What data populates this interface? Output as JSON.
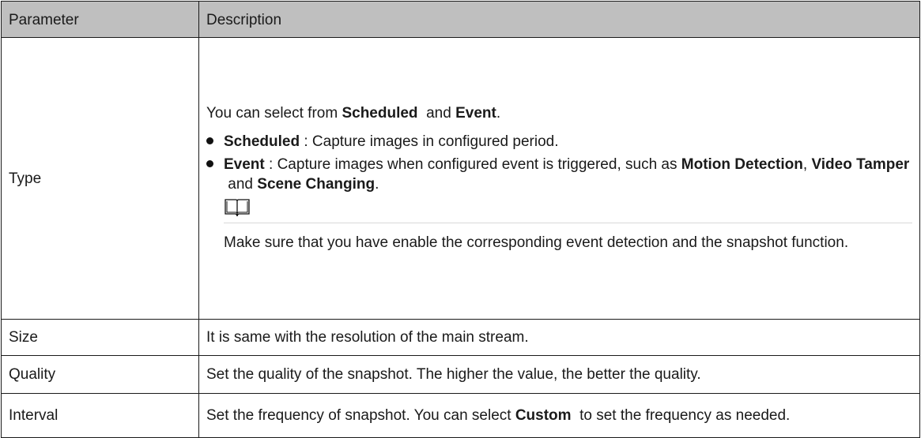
{
  "table": {
    "headers": {
      "parameter": "Parameter",
      "description": "Description"
    },
    "type_row": {
      "parameter": "Type",
      "intro": {
        "prefix": "You can select from ",
        "opt1": "Scheduled",
        "mid": "  and ",
        "opt2": "Event",
        "suffix": "."
      },
      "bullets": [
        {
          "term": "Scheduled",
          "text": " : Capture images in configured period."
        },
        {
          "term": "Event",
          "text": " : Capture images when configured event is triggered, such as ",
          "ev1": "Motion Detection",
          "sep1": ", ",
          "ev2": "Video Tamper",
          "sep2": " and ",
          "ev3": "Scene Changing",
          "end": "."
        }
      ],
      "note_icon": "book-icon",
      "note": "Make sure that you have enable the corresponding event detection and the snapshot function."
    },
    "size_row": {
      "parameter": "Size",
      "description": "It is same with the resolution of the main stream."
    },
    "quality_row": {
      "parameter": "Quality",
      "description": "Set the quality of the snapshot. The higher the value, the better the quality."
    },
    "interval_row": {
      "parameter": "Interval",
      "prefix": "Set the frequency of snapshot. You can select ",
      "option": "Custom",
      "suffix": "  to set the frequency as needed."
    }
  }
}
